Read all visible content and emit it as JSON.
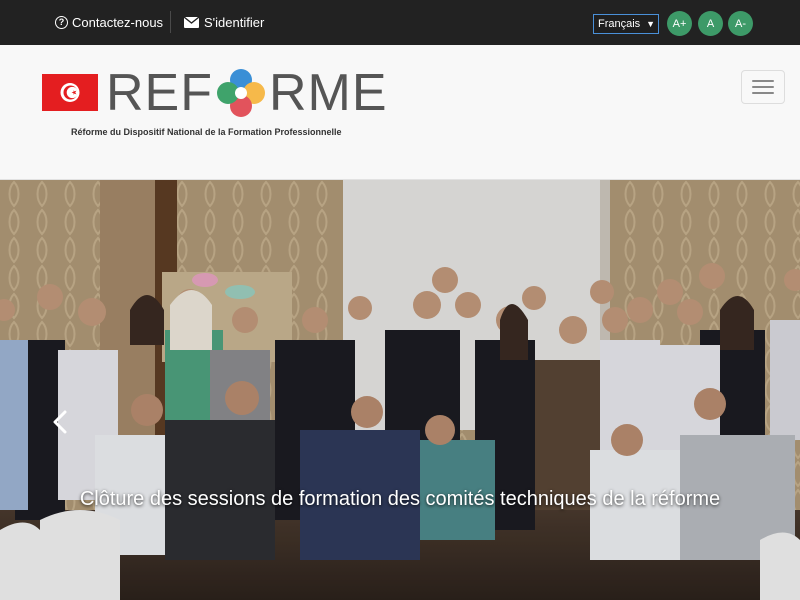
{
  "topbar": {
    "contact_label": "Contactez-nous",
    "login_label": "S'identifier",
    "language": "Français",
    "font_buttons": [
      "A+",
      "A",
      "A-"
    ]
  },
  "header": {
    "brand_left": "REF",
    "brand_right": "RME",
    "tagline": "Réforme du Dispositif National de la Formation Professionnelle"
  },
  "hero": {
    "caption": "Clôture des sessions de formation des comités techniques de la réforme"
  },
  "colors": {
    "topbar": "#222222",
    "accent_green": "#3d9a68",
    "flag_red": "#e41e20"
  }
}
